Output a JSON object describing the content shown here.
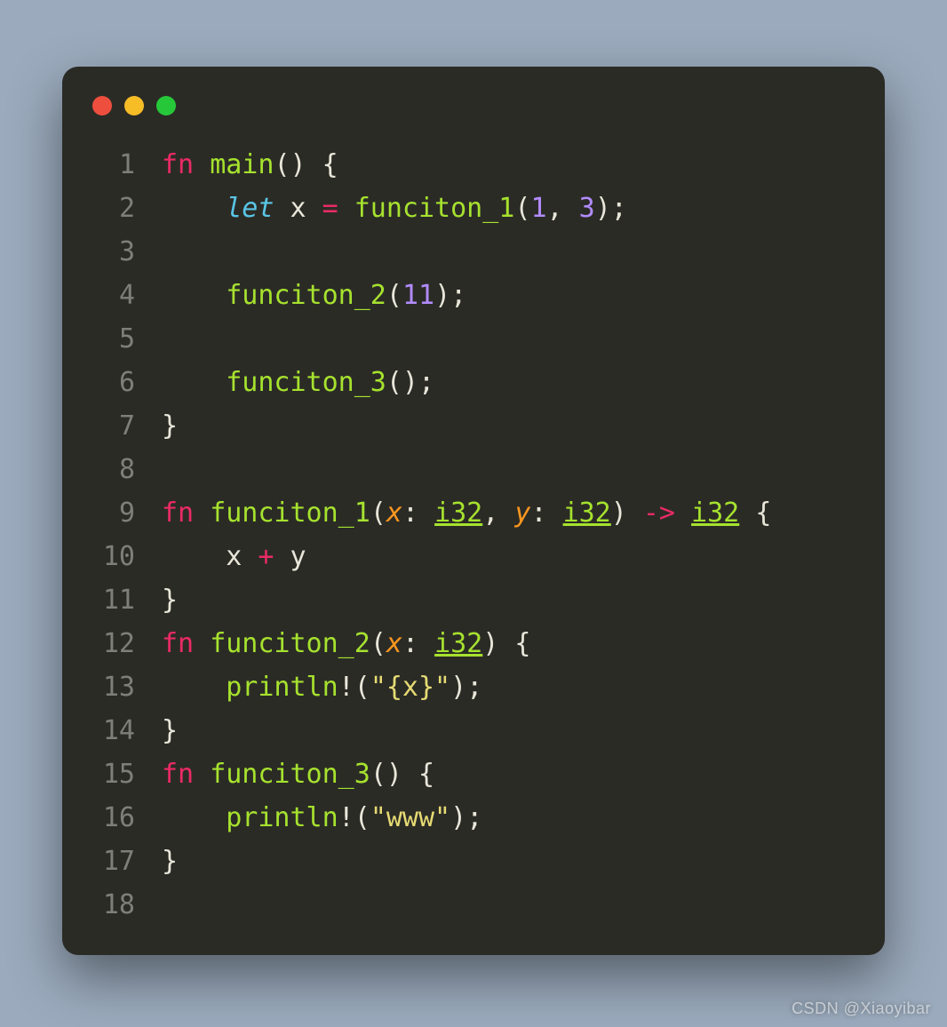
{
  "window": {
    "traffic_lights": [
      "close",
      "minimize",
      "zoom"
    ]
  },
  "code": {
    "lines": [
      {
        "n": "1",
        "tokens": [
          {
            "c": "tok-kw",
            "t": "fn"
          },
          {
            "c": "",
            "t": " "
          },
          {
            "c": "tok-fnname",
            "t": "main"
          },
          {
            "c": "tok-paren",
            "t": "()"
          },
          {
            "c": "",
            "t": " "
          },
          {
            "c": "tok-punct",
            "t": "{"
          }
        ]
      },
      {
        "n": "2",
        "tokens": [
          {
            "c": "",
            "t": "    "
          },
          {
            "c": "tok-let",
            "t": "let"
          },
          {
            "c": "",
            "t": " x "
          },
          {
            "c": "tok-op",
            "t": "="
          },
          {
            "c": "",
            "t": " "
          },
          {
            "c": "tok-fnname",
            "t": "funciton_1"
          },
          {
            "c": "tok-paren",
            "t": "("
          },
          {
            "c": "tok-num",
            "t": "1"
          },
          {
            "c": "tok-punct",
            "t": ", "
          },
          {
            "c": "tok-num",
            "t": "3"
          },
          {
            "c": "tok-paren",
            "t": ")"
          },
          {
            "c": "tok-punct",
            "t": ";"
          }
        ]
      },
      {
        "n": "3",
        "tokens": []
      },
      {
        "n": "4",
        "tokens": [
          {
            "c": "",
            "t": "    "
          },
          {
            "c": "tok-fnname",
            "t": "funciton_2"
          },
          {
            "c": "tok-paren",
            "t": "("
          },
          {
            "c": "tok-num",
            "t": "11"
          },
          {
            "c": "tok-paren",
            "t": ")"
          },
          {
            "c": "tok-punct",
            "t": ";"
          }
        ]
      },
      {
        "n": "5",
        "tokens": []
      },
      {
        "n": "6",
        "tokens": [
          {
            "c": "",
            "t": "    "
          },
          {
            "c": "tok-fnname",
            "t": "funciton_3"
          },
          {
            "c": "tok-paren",
            "t": "()"
          },
          {
            "c": "tok-punct",
            "t": ";"
          }
        ]
      },
      {
        "n": "7",
        "tokens": [
          {
            "c": "tok-punct",
            "t": "}"
          }
        ]
      },
      {
        "n": "8",
        "tokens": []
      },
      {
        "n": "9",
        "tokens": [
          {
            "c": "tok-kw",
            "t": "fn"
          },
          {
            "c": "",
            "t": " "
          },
          {
            "c": "tok-fnname",
            "t": "funciton_1"
          },
          {
            "c": "tok-paren",
            "t": "("
          },
          {
            "c": "tok-param",
            "t": "x"
          },
          {
            "c": "tok-punct",
            "t": ": "
          },
          {
            "c": "tok-type",
            "t": "i32"
          },
          {
            "c": "tok-punct",
            "t": ", "
          },
          {
            "c": "tok-param",
            "t": "y"
          },
          {
            "c": "tok-punct",
            "t": ": "
          },
          {
            "c": "tok-type",
            "t": "i32"
          },
          {
            "c": "tok-paren",
            "t": ")"
          },
          {
            "c": "",
            "t": " "
          },
          {
            "c": "tok-kw",
            "t": "->"
          },
          {
            "c": "",
            "t": " "
          },
          {
            "c": "tok-type",
            "t": "i32"
          },
          {
            "c": "",
            "t": " "
          },
          {
            "c": "tok-punct",
            "t": "{"
          }
        ]
      },
      {
        "n": "10",
        "tokens": [
          {
            "c": "",
            "t": "    x "
          },
          {
            "c": "tok-op",
            "t": "+"
          },
          {
            "c": "",
            "t": " y"
          }
        ]
      },
      {
        "n": "11",
        "tokens": [
          {
            "c": "tok-punct",
            "t": "}"
          }
        ]
      },
      {
        "n": "12",
        "tokens": [
          {
            "c": "tok-kw",
            "t": "fn"
          },
          {
            "c": "",
            "t": " "
          },
          {
            "c": "tok-fnname",
            "t": "funciton_2"
          },
          {
            "c": "tok-paren",
            "t": "("
          },
          {
            "c": "tok-param",
            "t": "x"
          },
          {
            "c": "tok-punct",
            "t": ": "
          },
          {
            "c": "tok-type",
            "t": "i32"
          },
          {
            "c": "tok-paren",
            "t": ")"
          },
          {
            "c": "",
            "t": " "
          },
          {
            "c": "tok-punct",
            "t": "{"
          }
        ]
      },
      {
        "n": "13",
        "tokens": [
          {
            "c": "",
            "t": "    "
          },
          {
            "c": "tok-fnname",
            "t": "println"
          },
          {
            "c": "tok-bang",
            "t": "!"
          },
          {
            "c": "tok-paren",
            "t": "("
          },
          {
            "c": "tok-str",
            "t": "\"{x}\""
          },
          {
            "c": "tok-paren",
            "t": ")"
          },
          {
            "c": "tok-punct",
            "t": ";"
          }
        ]
      },
      {
        "n": "14",
        "tokens": [
          {
            "c": "tok-punct",
            "t": "}"
          }
        ]
      },
      {
        "n": "15",
        "tokens": [
          {
            "c": "tok-kw",
            "t": "fn"
          },
          {
            "c": "",
            "t": " "
          },
          {
            "c": "tok-fnname",
            "t": "funciton_3"
          },
          {
            "c": "tok-paren",
            "t": "()"
          },
          {
            "c": "",
            "t": " "
          },
          {
            "c": "tok-punct",
            "t": "{"
          }
        ]
      },
      {
        "n": "16",
        "tokens": [
          {
            "c": "",
            "t": "    "
          },
          {
            "c": "tok-fnname",
            "t": "println"
          },
          {
            "c": "tok-bang",
            "t": "!"
          },
          {
            "c": "tok-paren",
            "t": "("
          },
          {
            "c": "tok-str",
            "t": "\"www\""
          },
          {
            "c": "tok-paren",
            "t": ")"
          },
          {
            "c": "tok-punct",
            "t": ";"
          }
        ]
      },
      {
        "n": "17",
        "tokens": [
          {
            "c": "tok-punct",
            "t": "}"
          }
        ]
      },
      {
        "n": "18",
        "tokens": []
      }
    ]
  },
  "watermark": "CSDN @Xiaoyibar"
}
